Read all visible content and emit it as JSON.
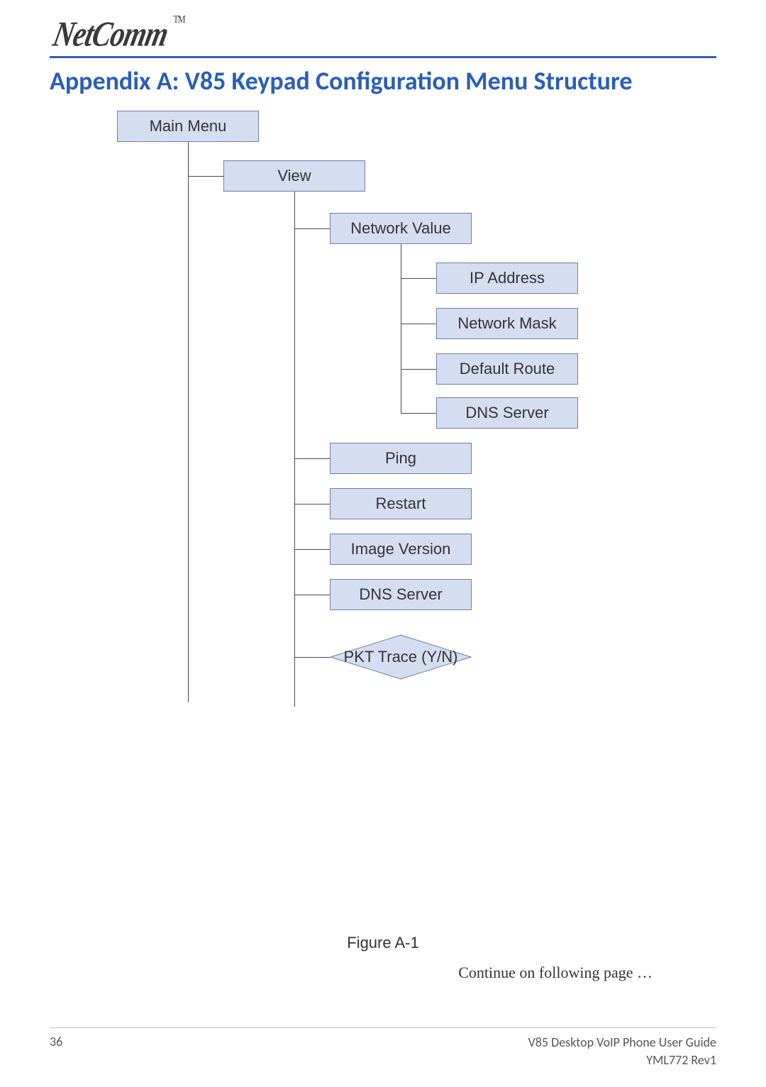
{
  "header": {
    "brand": "NetComm",
    "tm": "TM",
    "title": "Appendix A:  V85 Keypad Configuration Menu Structure"
  },
  "diagram": {
    "main_menu": "Main Menu",
    "view": "View",
    "network_value": "Network Value",
    "ip_address": "IP Address",
    "network_mask": "Network Mask",
    "default_route": "Default Route",
    "dns_server_leaf": "DNS Server",
    "ping": "Ping",
    "restart": "Restart",
    "image_version": "Image Version",
    "dns_server_view": "DNS Server",
    "pkt_trace": "PKT Trace (Y/N)"
  },
  "figure_label": "Figure A-1",
  "continue_text": "Continue on following page …",
  "footer": {
    "page_number": "36",
    "guide": "V85 Desktop VoIP Phone User Guide",
    "rev": "YML772 Rev1"
  }
}
